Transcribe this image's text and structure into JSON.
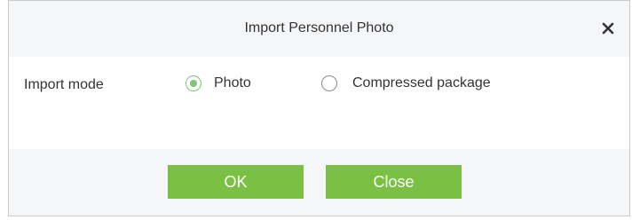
{
  "dialog": {
    "title": "Import Personnel Photo",
    "close_icon": "close-icon"
  },
  "form": {
    "import_mode_label": "Import mode",
    "options": [
      {
        "label": "Photo",
        "checked": true
      },
      {
        "label": "Compressed package",
        "checked": false
      }
    ]
  },
  "footer": {
    "ok_label": "OK",
    "close_label": "Close"
  },
  "colors": {
    "accent": "#7ac143",
    "radio_checked": "#7cc576",
    "header_bg": "#f5f6f8"
  }
}
